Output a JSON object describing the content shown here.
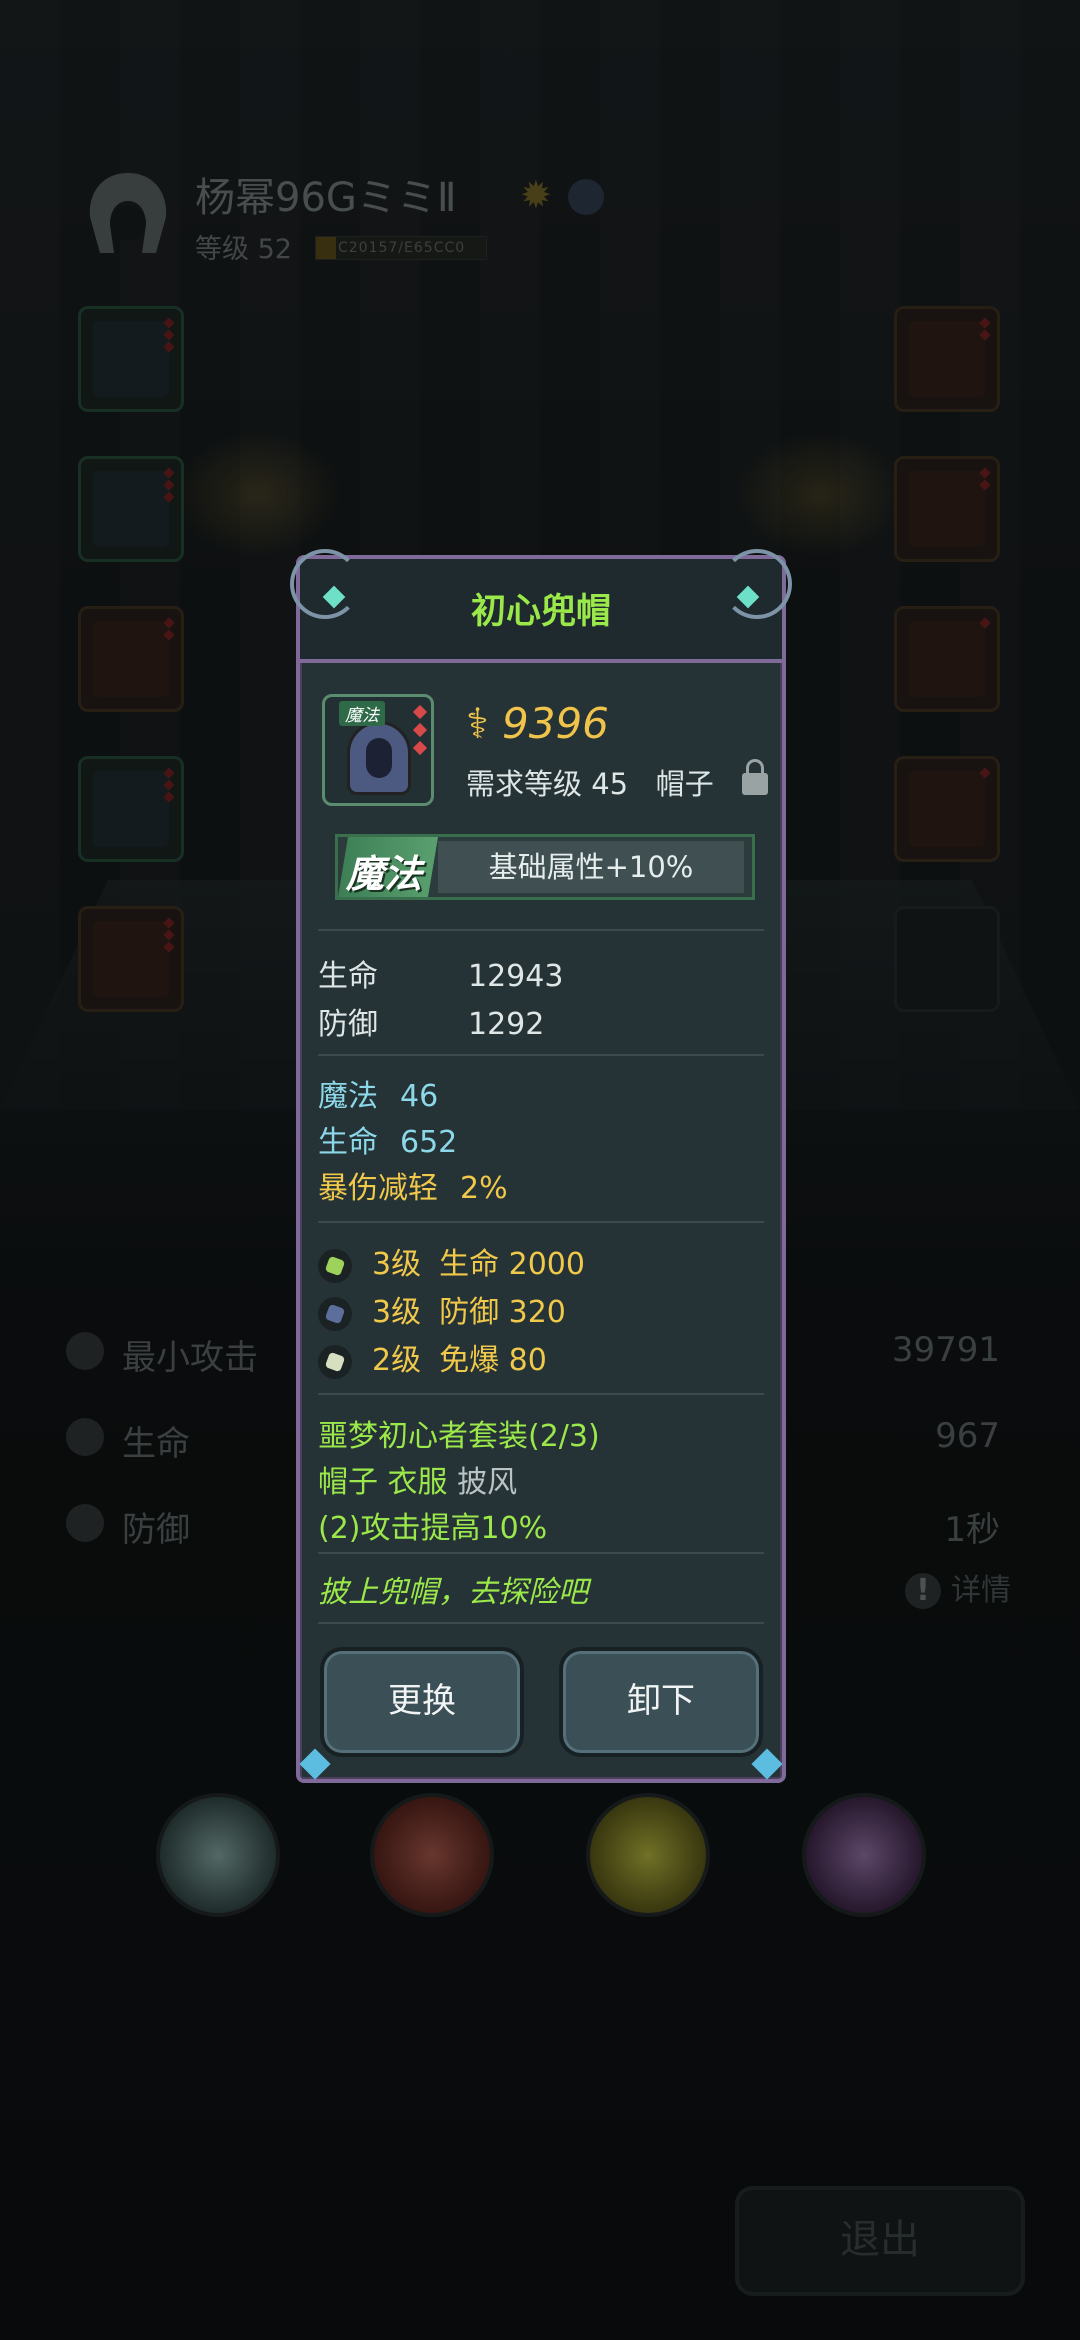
{
  "player": {
    "name": "杨幂96GミミⅡ",
    "level_label": "等级 52",
    "exp_text": "C20157/E65CC0",
    "exp_fraction": 0.12
  },
  "background_stats": [
    {
      "icon": "sword-icon",
      "label": "最小攻击",
      "value": "39791"
    },
    {
      "icon": "heart-icon",
      "label": "生命",
      "value": "967"
    },
    {
      "icon": "shield-icon",
      "label": "防御",
      "value": "1秒"
    }
  ],
  "detail_label": "详情",
  "exit_label": "退出",
  "item": {
    "title": "初心兜帽",
    "icon_tag": "魔法",
    "power": "9396",
    "requirement": "需求等级 45",
    "slot_type": "帽子",
    "quality_label": "魔法",
    "quality_desc": "基础属性+10%",
    "base_stats": [
      {
        "label": "生命",
        "value": "12943"
      },
      {
        "label": "防御",
        "value": "1292"
      }
    ],
    "extra_stats": [
      {
        "label": "魔法",
        "value": "46",
        "color": "#8cd8e8"
      },
      {
        "label": "生命",
        "value": "652",
        "color": "#8cd8e8"
      },
      {
        "label": "暴伤减轻",
        "value": "2%",
        "color": "#f0c84a"
      }
    ],
    "gems": [
      {
        "level": "3级",
        "text": "生命 2000",
        "color": "#9ed25a"
      },
      {
        "level": "3级",
        "text": "防御 320",
        "color": "#5c6f9a"
      },
      {
        "level": "2级",
        "text": "免爆 80",
        "color": "#d6e0c0"
      }
    ],
    "set_name": "噩梦初心者套装(2/3)",
    "set_parts_active": "帽子 衣服",
    "set_parts_inactive": "披风",
    "set_bonus": "(2)攻击提高10%",
    "flavor": "披上兜帽，去探险吧",
    "buttons": {
      "replace": "更换",
      "unequip": "卸下"
    }
  },
  "colors": {
    "panel_border": "#7f6a99",
    "title": "#9be84a",
    "power": "#f0c44a",
    "background": "#15191b"
  }
}
